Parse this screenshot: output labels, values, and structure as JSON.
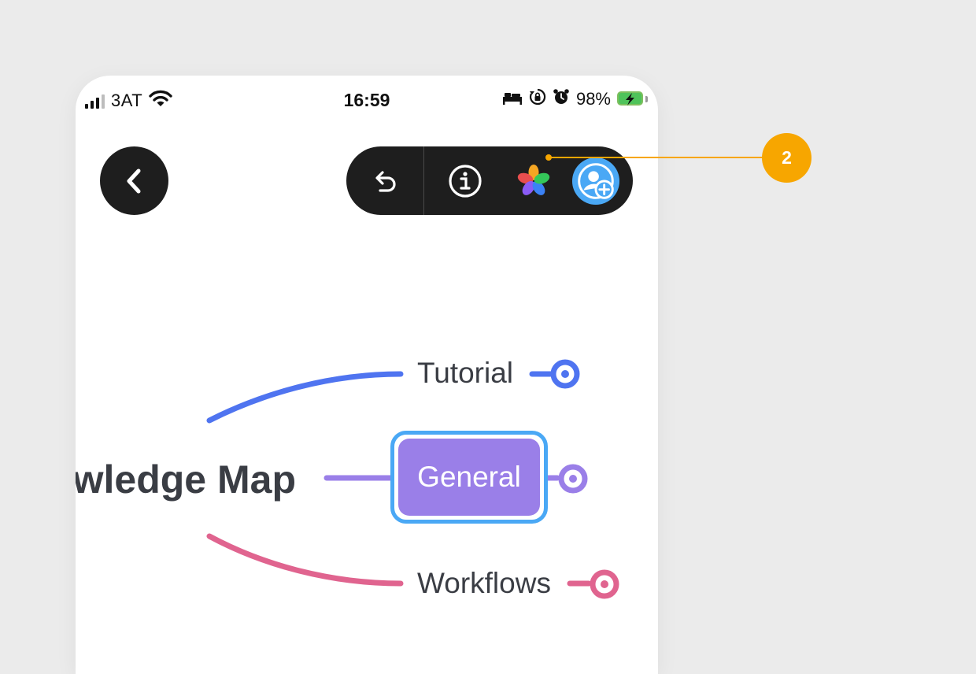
{
  "status_bar": {
    "carrier": "3AT",
    "time": "16:59",
    "battery": "98%"
  },
  "toolbar": {
    "buttons": [
      {
        "name": "undo",
        "icon": "undo-icon"
      },
      {
        "name": "info",
        "icon": "info-icon"
      },
      {
        "name": "theme",
        "icon": "color-palette-icon"
      },
      {
        "name": "add-collaborator",
        "icon": "add-user-icon"
      }
    ]
  },
  "mind_map": {
    "root": "Knowledge Map",
    "branches": [
      {
        "label": "Tutorial",
        "color": "#4f74f0"
      },
      {
        "label": "General",
        "color": "#9a7fe8",
        "selected": true
      },
      {
        "label": "Workflows",
        "color": "#e0648f"
      }
    ],
    "selection_color": "#4aa8f5"
  },
  "annotation": {
    "badge": "2",
    "color": "#f7a600"
  }
}
